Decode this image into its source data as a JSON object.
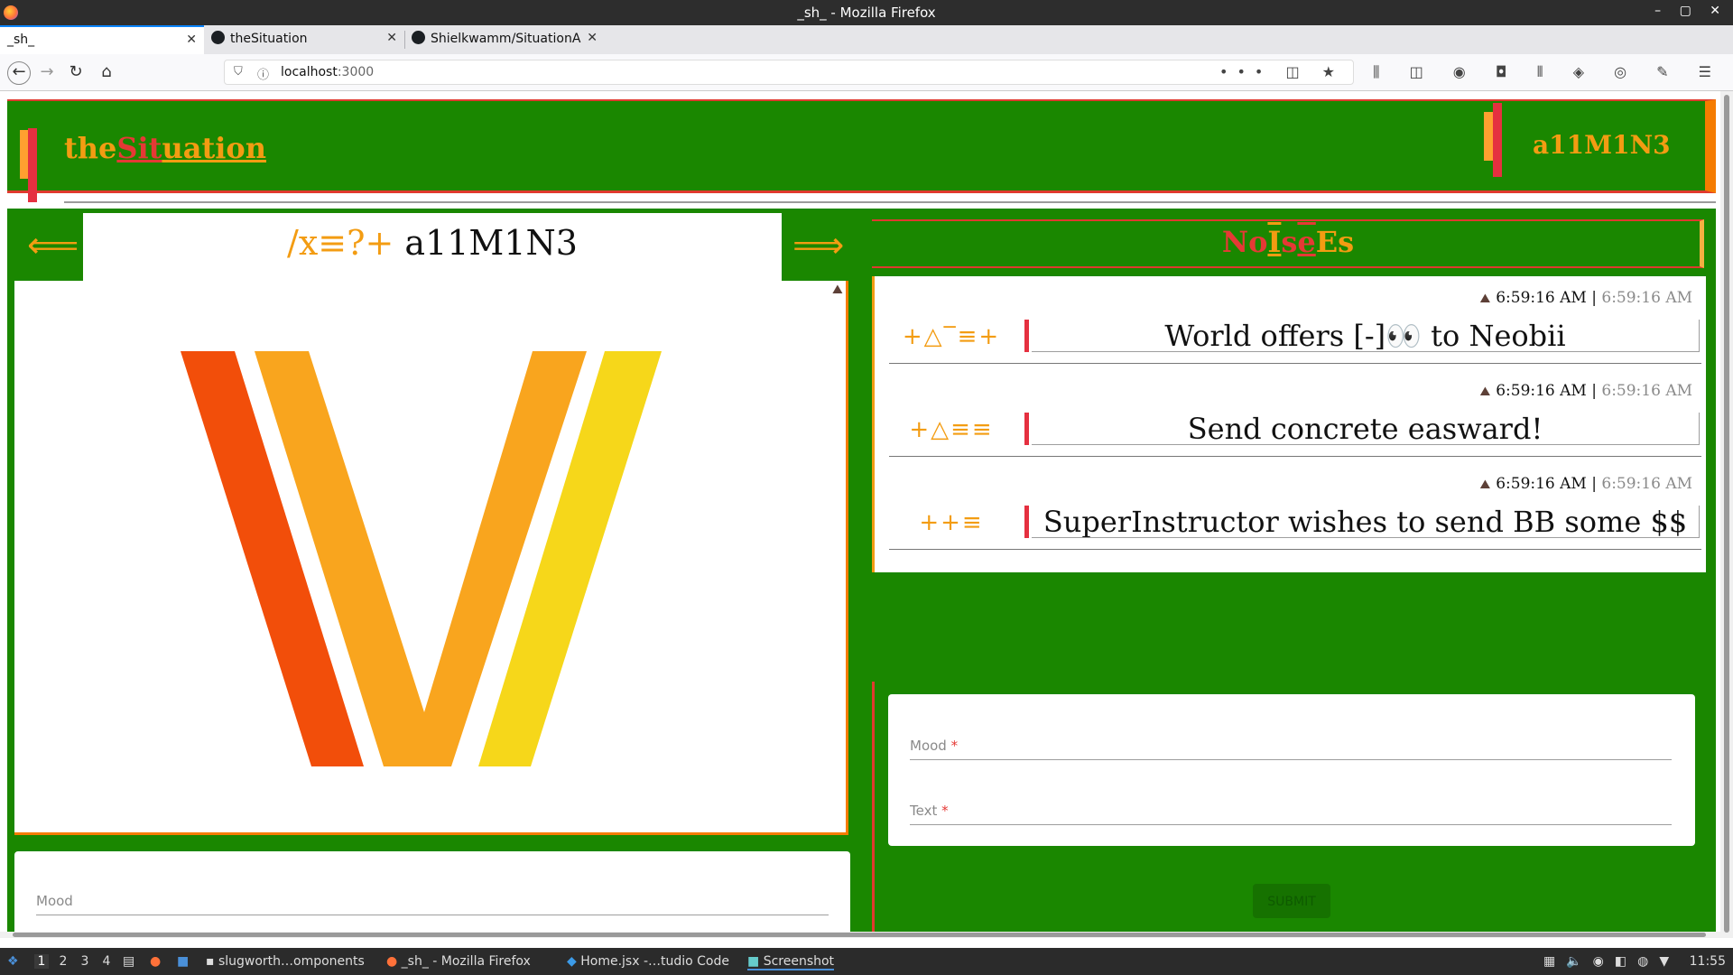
{
  "window": {
    "title": "_sh_ - Mozilla Firefox",
    "controls": "– ▢ ✕"
  },
  "tabs": [
    {
      "label": "_sh_",
      "active": true
    },
    {
      "label": "theSituation",
      "active": false
    },
    {
      "label": "Shielkwamm/SituationA",
      "active": false
    }
  ],
  "nav": {
    "url_host": "localhost",
    "url_port": ":3000",
    "page_actions": "••• ◫ ★",
    "tool_icons": "⫼ ◫ ◉ ◘ ⦀ ◈ ◎ ✎ ☰"
  },
  "header": {
    "brand_the": "the",
    "brand_sit": "Sit",
    "brand_uation": "uation",
    "username": "a11M1N3"
  },
  "left_panel": {
    "arrow_left": "⟸",
    "arrow_right": "⟹",
    "title_glyphs": "/x≡?+",
    "title_name": "a11M1N3",
    "form": {
      "mood_label": "Mood"
    }
  },
  "noises": {
    "title_parts": [
      "No",
      "I",
      "s",
      "e",
      "Es"
    ],
    "items": [
      {
        "time": "6:59:16 AM",
        "time_grey": "6:59:16 AM",
        "mood": "+△‾≡+",
        "text": "World offers [-]👀 to Neobii"
      },
      {
        "time": "6:59:16 AM",
        "time_grey": "6:59:16 AM",
        "mood": "+△≡≡",
        "text": "Send concrete easward!"
      },
      {
        "time": "6:59:16 AM",
        "time_grey": "6:59:16 AM",
        "mood": "++≡",
        "text": "SuperInstructor wishes to send BB some $$"
      }
    ],
    "separator": " | "
  },
  "right_form": {
    "mood_label": "Mood",
    "text_label": "Text",
    "required_mark": "*",
    "submit_label": "SUBMIT"
  },
  "taskbar": {
    "workspaces": [
      "1",
      "2",
      "3",
      "4"
    ],
    "tasks": [
      "slugworth…omponents",
      "_sh_ - Mozilla Firefox",
      "Home.jsx -…tudio Code",
      "Screenshot"
    ],
    "clock": "11:55"
  },
  "colors": {
    "green": "#1a8700",
    "orange": "#f39c12",
    "red": "#e53935",
    "logo_red": "#f24e0a",
    "logo_orange": "#f9a51e",
    "logo_yellow": "#f6d71a"
  }
}
